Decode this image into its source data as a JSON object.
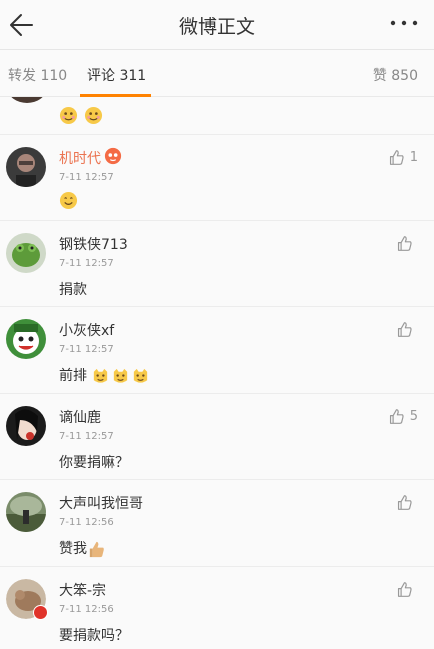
{
  "header": {
    "title": "微博正文",
    "back_icon": "back-arrow-icon",
    "more_icon": "more-dots-icon"
  },
  "tabs": {
    "repost": "转发 110",
    "comment": "评论 311",
    "like": "赞 850",
    "active_color": "#ff8200"
  },
  "partial_comment": {
    "emoji": [
      "doge-emoji-icon",
      "doge-emoji-icon"
    ]
  },
  "comments": [
    {
      "username": "机时代",
      "username_color": "#eb7350",
      "has_badge_emoji": true,
      "time": "7-11 12:57",
      "likes": "1",
      "content_text": "",
      "content_emoji": [
        "smile-emoji-icon"
      ]
    },
    {
      "username": "钢铁侠713",
      "time": "7-11 12:57",
      "likes": "",
      "content_text": "捐款",
      "content_emoji": []
    },
    {
      "username": "小灰侠xf",
      "time": "7-11 12:57",
      "likes": "",
      "content_text": "前排",
      "content_emoji": [
        "cat-emoji-icon",
        "cat-emoji-icon",
        "cat-emoji-icon"
      ]
    },
    {
      "username": "谪仙鹿",
      "time": "7-11 12:57",
      "likes": "5",
      "content_text": "你要捐嘛？",
      "content_emoji": []
    },
    {
      "username": "大声叫我恒哥",
      "time": "7-11 12:56",
      "likes": "",
      "content_text": "赞我",
      "content_emoji": [
        "thumbs-up-emoji-icon"
      ]
    },
    {
      "username": "大笨-宗",
      "time": "7-11 12:56",
      "likes": "",
      "content_text": "要捐款吗？",
      "content_emoji": []
    }
  ]
}
